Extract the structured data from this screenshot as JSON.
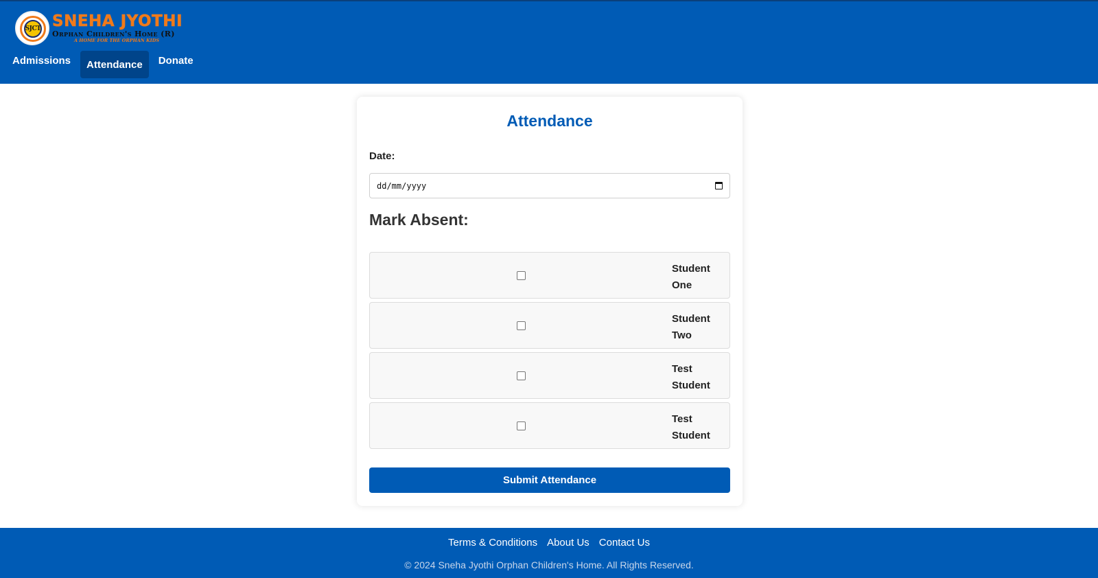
{
  "brand": {
    "emblem_text": "SJCT",
    "title": "SNEHA JYOTHI",
    "subtitle": "Orphan Children's Home (R)",
    "tagline": "A home for the orphan kids"
  },
  "nav": {
    "items": [
      {
        "label": "Admissions",
        "active": false
      },
      {
        "label": "Attendance",
        "active": true
      },
      {
        "label": "Donate",
        "active": false
      }
    ]
  },
  "form": {
    "title": "Attendance",
    "date_label": "Date:",
    "date_placeholder": "dd/mm/yyyy",
    "section_title": "Mark Absent:",
    "students": [
      {
        "name": "Student One",
        "checked": false
      },
      {
        "name": "Student Two",
        "checked": false
      },
      {
        "name": "Test Student",
        "checked": false
      },
      {
        "name": "Test Student",
        "checked": false
      }
    ],
    "submit_label": "Submit Attendance"
  },
  "footer": {
    "links": [
      "Terms & Conditions",
      "About Us",
      "Contact Us"
    ],
    "copyright": "© 2024 Sneha Jyothi Orphan Children's Home. All Rights Reserved."
  },
  "colors": {
    "primary": "#005bb5",
    "nav_active": "#00448a",
    "brand_orange": "#f07a1a"
  }
}
